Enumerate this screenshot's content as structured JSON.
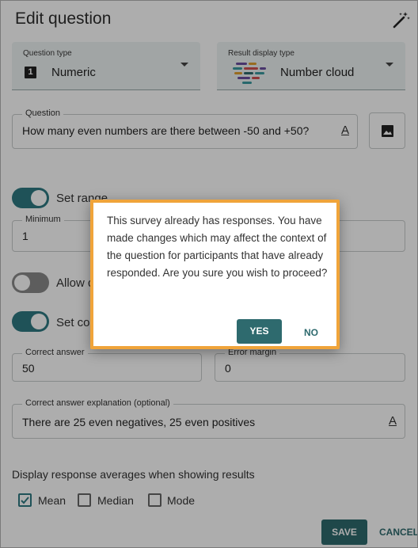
{
  "header": {
    "title": "Edit question",
    "wand_icon": "magic-wand-icon"
  },
  "question_type": {
    "label": "Question type",
    "value": "Numeric",
    "icon_glyph": "1"
  },
  "result_display_type": {
    "label": "Result display type",
    "value": "Number cloud"
  },
  "question": {
    "label": "Question",
    "value": "How many even numbers are there between -50 and +50?",
    "format_glyph": "A"
  },
  "range": {
    "toggle_label": "Set range",
    "enabled": true
  },
  "minimum": {
    "label": "Minimum",
    "value": "1"
  },
  "allow": {
    "toggle_label": "Allow d",
    "enabled": false
  },
  "correct": {
    "toggle_label": "Set co",
    "enabled": true
  },
  "correct_answer": {
    "label": "Correct answer",
    "value": "50"
  },
  "error_margin": {
    "label": "Error margin",
    "value": "0"
  },
  "explanation": {
    "label": "Correct answer explanation (optional)",
    "value": "There are 25 even negatives, 25 even positives",
    "format_glyph": "A"
  },
  "averages": {
    "heading": "Display response averages when showing results",
    "options": [
      {
        "label": "Mean",
        "checked": true
      },
      {
        "label": "Median",
        "checked": false
      },
      {
        "label": "Mode",
        "checked": false
      }
    ]
  },
  "footer": {
    "save": "SAVE",
    "cancel": "CANCEL"
  },
  "dialog": {
    "message": "This survey already has responses. You have made changes which may affect the context of the question for participants that have already responded. Are you sure you wish to proceed?",
    "yes": "YES",
    "no": "NO"
  },
  "colors": {
    "accent": "#2e6a6e",
    "toggle_on": "#2e7a82",
    "dialog_border": "#f0a43a"
  }
}
